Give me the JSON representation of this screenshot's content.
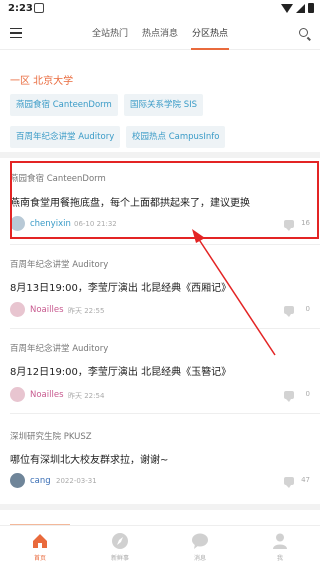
{
  "status_bar": {
    "time": "2:23"
  },
  "top_nav": {
    "tabs": [
      {
        "label": "全站热门"
      },
      {
        "label": "热点消息"
      },
      {
        "label": "分区热点"
      }
    ],
    "active_tab": "分区热点"
  },
  "section": {
    "header": "一区 北京大学",
    "chips": [
      {
        "label": "燕园食宿 CanteenDorm"
      },
      {
        "label": "国际关系学院 SIS"
      },
      {
        "label": "百周年纪念讲堂 Auditory"
      },
      {
        "label": "校园热点 CampusInfo"
      }
    ]
  },
  "posts": [
    {
      "board": "燕园食宿 CanteenDorm",
      "title": "燕南食堂用餐拖底盘，每个上面都拱起来了，建议更换",
      "author": "chenyixin",
      "time": "06-10 21:32",
      "comments": "16"
    },
    {
      "board": "百周年纪念讲堂 Auditory",
      "title": "8月13日19:00，李莹厅演出 北昆经典《西厢记》",
      "author": "Noailles",
      "time": "昨天 22:55",
      "comments": "0"
    },
    {
      "board": "百周年纪念讲堂 Auditory",
      "title": "8月12日19:00，李莹厅演出 北昆经典《玉簪记》",
      "author": "Noailles",
      "time": "昨天 22:54",
      "comments": "0"
    },
    {
      "board": "深圳研究生院 PKUSZ",
      "title": "哪位有深圳北大校友群求拉，谢谢~",
      "author": "cang",
      "time": "2022-03-31",
      "comments": "47"
    }
  ],
  "bottom_nav": [
    {
      "label": "首页",
      "icon": "home-icon"
    },
    {
      "label": "新鲜事",
      "icon": "compass-icon"
    },
    {
      "label": "消息",
      "icon": "chat-icon"
    },
    {
      "label": "我",
      "icon": "person-icon"
    }
  ],
  "colors": {
    "accent": "#e96a3c",
    "chip_text": "#3a9bc7",
    "highlight": "#e32424"
  }
}
